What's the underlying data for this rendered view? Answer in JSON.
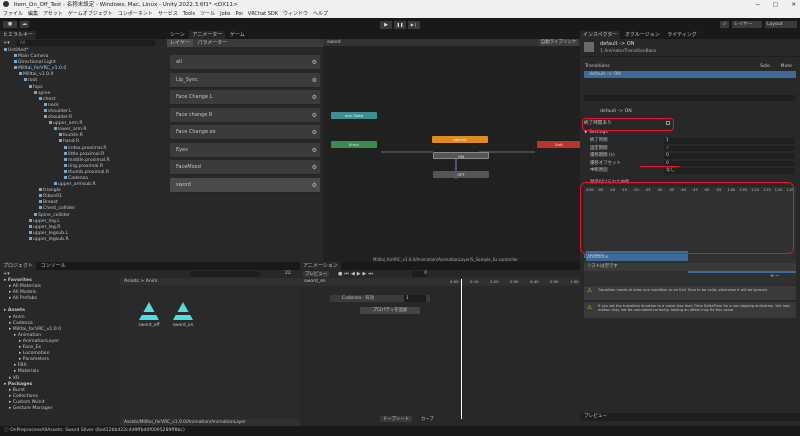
{
  "window": {
    "title": "Item_On_Off_Test - 名称未設定 - Windows, Mac, Linux - Unity 2022.3.6f1* <DX11>",
    "controls": [
      "─",
      "□",
      "✕"
    ]
  },
  "menu": [
    "ファイル",
    "編集",
    "アセット",
    "ゲームオブジェクト",
    "コンポーネント",
    "サービス",
    "Tools",
    "ツール",
    "Jobs",
    "Poi",
    "VRChat SDK",
    "ウィンドウ",
    "ヘルプ"
  ],
  "toolbar": {
    "account": "●",
    "cloud": "☁",
    "search": "⌕",
    "layers": "レイヤー",
    "layout": "Layout"
  },
  "hierarchy": {
    "tab": "ヒエラルキー",
    "search_hint": "All",
    "items": [
      {
        "label": "Untitled*",
        "d": 0,
        "sel": false
      },
      {
        "label": "Main Camera",
        "d": 2,
        "sel": false
      },
      {
        "label": "Directional Light",
        "d": 2,
        "sel": false
      },
      {
        "label": "Milltai_forVRC_v1.0.0",
        "d": 2,
        "sel": true
      },
      {
        "label": "Milltai_v1.0.0",
        "d": 3,
        "sel": false
      },
      {
        "label": "root",
        "d": 4,
        "sel": false
      },
      {
        "label": "hips",
        "d": 5,
        "sel": false
      },
      {
        "label": "spine",
        "d": 6,
        "sel": false
      },
      {
        "label": "chest",
        "d": 7,
        "sel": false
      },
      {
        "label": "neck",
        "d": 8,
        "sel": false
      },
      {
        "label": "shoulder.L",
        "d": 8,
        "sel": false
      },
      {
        "label": "shoulder.R",
        "d": 8,
        "sel": false
      },
      {
        "label": "upper_arm.R",
        "d": 9,
        "sel": false
      },
      {
        "label": "lower_arm.R",
        "d": 10,
        "sel": false
      },
      {
        "label": "buckle.R",
        "d": 11,
        "sel": false
      },
      {
        "label": "hand.R",
        "d": 11,
        "sel": false
      },
      {
        "label": "index.proximal.R",
        "d": 12,
        "sel": false
      },
      {
        "label": "little.proximal.R",
        "d": 12,
        "sel": false
      },
      {
        "label": "middle.proximal.R",
        "d": 12,
        "sel": false
      },
      {
        "label": "ring.proximal.R",
        "d": 12,
        "sel": false
      },
      {
        "label": "thumb.proximal.R",
        "d": 12,
        "sel": false
      },
      {
        "label": "Cadenza",
        "d": 12,
        "sel": false
      },
      {
        "label": "upper_armsub.R",
        "d": 10,
        "sel": false
      },
      {
        "label": "triangle",
        "d": 7,
        "sel": false
      },
      {
        "label": "Ribon01",
        "d": 7,
        "sel": false
      },
      {
        "label": "Breast",
        "d": 7,
        "sel": false
      },
      {
        "label": "Chest_collider",
        "d": 7,
        "sel": false
      },
      {
        "label": "Spine_collider",
        "d": 6,
        "sel": false
      },
      {
        "label": "upper_leg.L",
        "d": 5,
        "sel": false
      },
      {
        "label": "upper_leg.R",
        "d": 5,
        "sel": false
      },
      {
        "label": "upper_legsub.L",
        "d": 5,
        "sel": false
      },
      {
        "label": "upper_legsub.R",
        "d": 5,
        "sel": false
      }
    ]
  },
  "scene_tabs": [
    "シーン",
    "アニメーター",
    "ゲーム"
  ],
  "animator": {
    "tabs": [
      "レイヤー",
      "パラメーター"
    ],
    "breadcrumb": "sword",
    "auto_live": "自動ライブリンク",
    "layers": [
      "all",
      "Lip_Sync",
      "Face Change L",
      "Face change R",
      "Face Change ex",
      "Eyes",
      "FaceMood",
      "sword"
    ],
    "nodes": {
      "any": "Any State",
      "entry": "Entry",
      "default": "default",
      "on": "ON",
      "off": "OFF",
      "exit": "Exit"
    },
    "path": "Milltai_forVRC_v1.0.0/Animation/AnimationLayer/S_Sample_Ex.controller"
  },
  "play": {
    "play": "▶",
    "pause": "❚❚",
    "step": "▶❘"
  },
  "project": {
    "tabs": [
      "プロジェクト",
      "コンソール"
    ],
    "count": "22",
    "tree": [
      {
        "label": "Favorites",
        "d": 0,
        "b": true
      },
      {
        "label": "All Materials",
        "d": 1,
        "b": false
      },
      {
        "label": "All Models",
        "d": 1,
        "b": false
      },
      {
        "label": "All Prefabs",
        "d": 1,
        "b": false
      },
      {
        "label": "",
        "d": 0,
        "b": false
      },
      {
        "label": "Assets",
        "d": 0,
        "b": true
      },
      {
        "label": "Anim",
        "d": 1,
        "b": false
      },
      {
        "label": "Cadenza",
        "d": 1,
        "b": false
      },
      {
        "label": "Milltai_forVRC_v1.0.0",
        "d": 1,
        "b": false
      },
      {
        "label": "Animation",
        "d": 2,
        "b": false
      },
      {
        "label": "AnimationLayer",
        "d": 3,
        "b": false
      },
      {
        "label": "Face_Ex",
        "d": 3,
        "b": false
      },
      {
        "label": "Locomotion",
        "d": 3,
        "b": false
      },
      {
        "label": "Parameters",
        "d": 3,
        "b": false
      },
      {
        "label": "FBX",
        "d": 2,
        "b": false
      },
      {
        "label": "Materials",
        "d": 2,
        "b": false
      },
      {
        "label": "XR",
        "d": 1,
        "b": false
      },
      {
        "label": "Packages",
        "d": 0,
        "b": true
      },
      {
        "label": "Burst",
        "d": 1,
        "b": false
      },
      {
        "label": "Collections",
        "d": 1,
        "b": false
      },
      {
        "label": "Custom NUnit",
        "d": 1,
        "b": false
      },
      {
        "label": "Gesture Manager",
        "d": 1,
        "b": false
      }
    ],
    "crumb": "Assets > Anim",
    "files": [
      "sword_off",
      "sword_on"
    ],
    "footer_path": "Assets/Milltai_forVRC_v1.0.0/Animation/AnimationLayer"
  },
  "animation": {
    "tab": "アニメーション",
    "preview": "プレビュー",
    "clip": "sword_on",
    "frame": "0",
    "prop": "Cadenza : 有効",
    "prop_val": "1",
    "add": "プロパティを追加",
    "ticks": [
      "0:00",
      "0:10",
      "0:20",
      "0:30",
      "0:40",
      "0:50",
      "1:00"
    ],
    "bottom": [
      "ドープシート",
      "カーブ"
    ]
  },
  "inspector": {
    "tabs": [
      "インスペクター",
      "オクルージョン",
      "ライティング"
    ],
    "title": "default -> ON",
    "subtitle": "1 AnimatorTransitionBase",
    "transitions_label": "Transitions",
    "solo": "Solo",
    "mute": "Mute",
    "transition_row": "default -> ON",
    "name": "default -> ON",
    "has_exit_time": "終了時間あり",
    "settings": "Settings",
    "fields": [
      {
        "label": "終了時間",
        "value": "1"
      },
      {
        "label": "固定期間",
        "value": "✓"
      },
      {
        "label": "遷移期間 (s)",
        "value": "0"
      },
      {
        "label": "遷移オフセット",
        "value": "0"
      },
      {
        "label": "中断原因",
        "value": "なし"
      }
    ],
    "ordered": "順序付けられた中断",
    "tl_ticks": [
      "0:00",
      ":05",
      ":10",
      ":15",
      ":20",
      ":25",
      ":30",
      ":35",
      ":40",
      ":45",
      ":50",
      ":55",
      "1:00",
      "1:05",
      "1:10",
      "1:15",
      "1:20",
      "1:25"
    ],
    "bar1": "default",
    "bar2": "ON",
    "conditions": "Conditions",
    "list_empty": "リストは空です",
    "warn1": "Transition needs at least one condition or an Exit Time to be valid, otherwise it will be ignored.",
    "warn2": "If you set the transition duration to a value less than Time DeltaTime for a non-looping animation, the root motion may not be calculated correctly. Adding an offset may fix this value.",
    "preview": "プレビュー"
  },
  "status": {
    "text": "OnPreprocessAllAssets: Sword Silver (6ed12bb422c4d9ffbd0f0095289ff8bc)"
  },
  "colors": {
    "orange": "#e08a1d",
    "red": "#b8352b",
    "green": "#3d8a4f",
    "teal": "#3d8f92",
    "grey": "#555555",
    "highlight": "#e8132b",
    "bar": "#3e6a9a"
  }
}
